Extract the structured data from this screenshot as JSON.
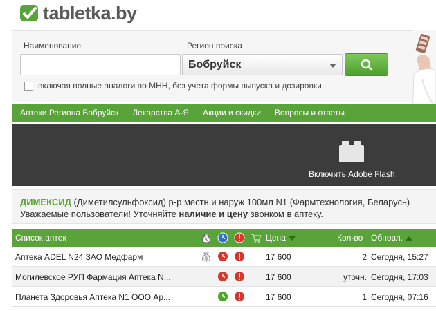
{
  "header": {
    "logo_text": "tabletka.by"
  },
  "search": {
    "name_label": "Наименование",
    "name_value": "",
    "region_label": "Регион поиска",
    "region_value": "Бобруйск",
    "checkbox_label": "включая полные аналоги по МНН, без учета формы выпуска и дозировки",
    "checkbox_checked": false
  },
  "nav": {
    "items": [
      {
        "label": "Аптеки Региона Бобруйск"
      },
      {
        "label": "Лекарства А-Я"
      },
      {
        "label": "Акции и скидки"
      },
      {
        "label": "Вопросы и ответы"
      }
    ]
  },
  "flash": {
    "link_label": "Включить Adobe Flash"
  },
  "drug": {
    "name": "ДИМЕКСИД",
    "description": " (Диметилсульфоксид) р-р местн и наруж 100мл N1 (Фармтехнология, Беларусь)",
    "notice_prefix": "Уважаемые пользователи! Уточняйте ",
    "notice_bold": "наличие и цену",
    "notice_suffix": " звонком в аптеку."
  },
  "table": {
    "headers": {
      "list": "Список аптек",
      "price": "Цена",
      "qty": "Кол-во",
      "updated": "Обновл."
    },
    "rows": [
      {
        "pharmacy": "Аптека ADEL N24 ЗАО Медфарм",
        "discount": true,
        "clock": "red",
        "price": "17 600",
        "qty": "2",
        "updated": "Сегодня, 15:27"
      },
      {
        "pharmacy": "Могилевское РУП Фармация Аптека N...",
        "discount": false,
        "clock": "red",
        "price": "17 600",
        "qty": "уточн.",
        "updated": "Сегодня, 17:03"
      },
      {
        "pharmacy": "Планета Здоровья Аптека N1 ООО Ар...",
        "discount": false,
        "clock": "green",
        "price": "17 600",
        "qty": "1",
        "updated": "Сегодня, 07:16"
      }
    ]
  },
  "colors": {
    "brand_green": "#5aa23a",
    "alert_red": "#d9362b",
    "clock_green": "#4ca62c"
  }
}
